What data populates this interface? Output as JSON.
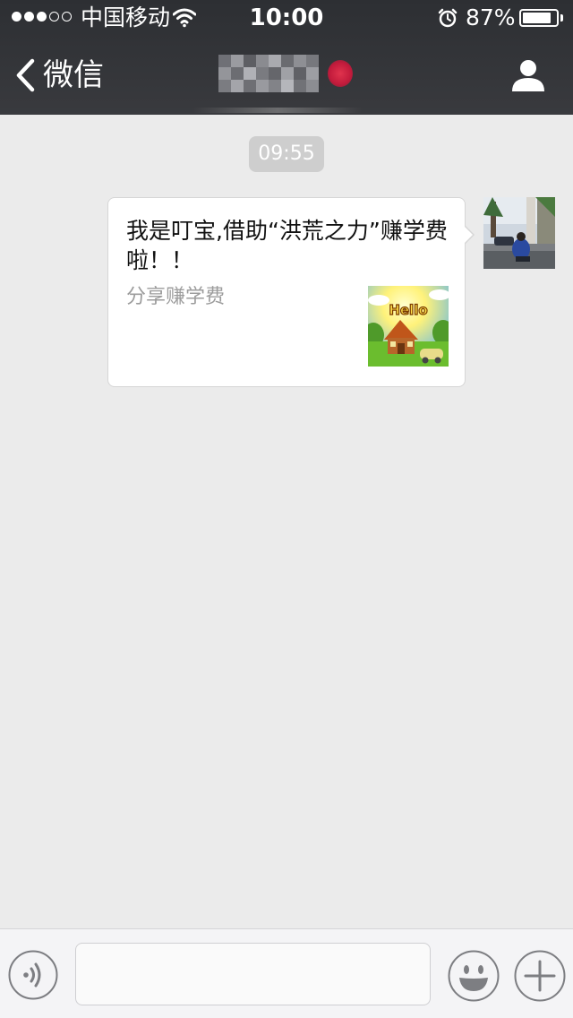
{
  "status_bar": {
    "carrier": "中国移动",
    "time": "10:00",
    "battery_percent": "87%",
    "battery_level": 0.87,
    "signal_bars_filled": 3,
    "signal_bars_total": 5,
    "icons": [
      "signal-dots-icon",
      "wifi-icon",
      "alarm-clock-icon",
      "battery-icon"
    ]
  },
  "nav": {
    "back_label": "微信",
    "chat_title_blurred": true,
    "icons": [
      "chevron-left-icon",
      "profile-icon"
    ]
  },
  "chat": {
    "timestamp": "09:55",
    "messages": [
      {
        "type": "link-card",
        "sender": "self",
        "title": "我是叮宝,借助“洪荒之力”赚学费啦！！",
        "description": "分享赚学费",
        "thumbnail_text": "Hello"
      }
    ]
  },
  "input_bar": {
    "value": "",
    "icons": [
      "voice-icon",
      "emoji-icon",
      "plus-icon"
    ]
  },
  "colors": {
    "header_bg": "#393a3e",
    "chat_bg": "#ebebeb",
    "bubble_bg": "#ffffff",
    "timestamp_bg": "#cecece",
    "input_bar_bg": "#f4f4f6",
    "muted_text": "#9c9c9c"
  }
}
